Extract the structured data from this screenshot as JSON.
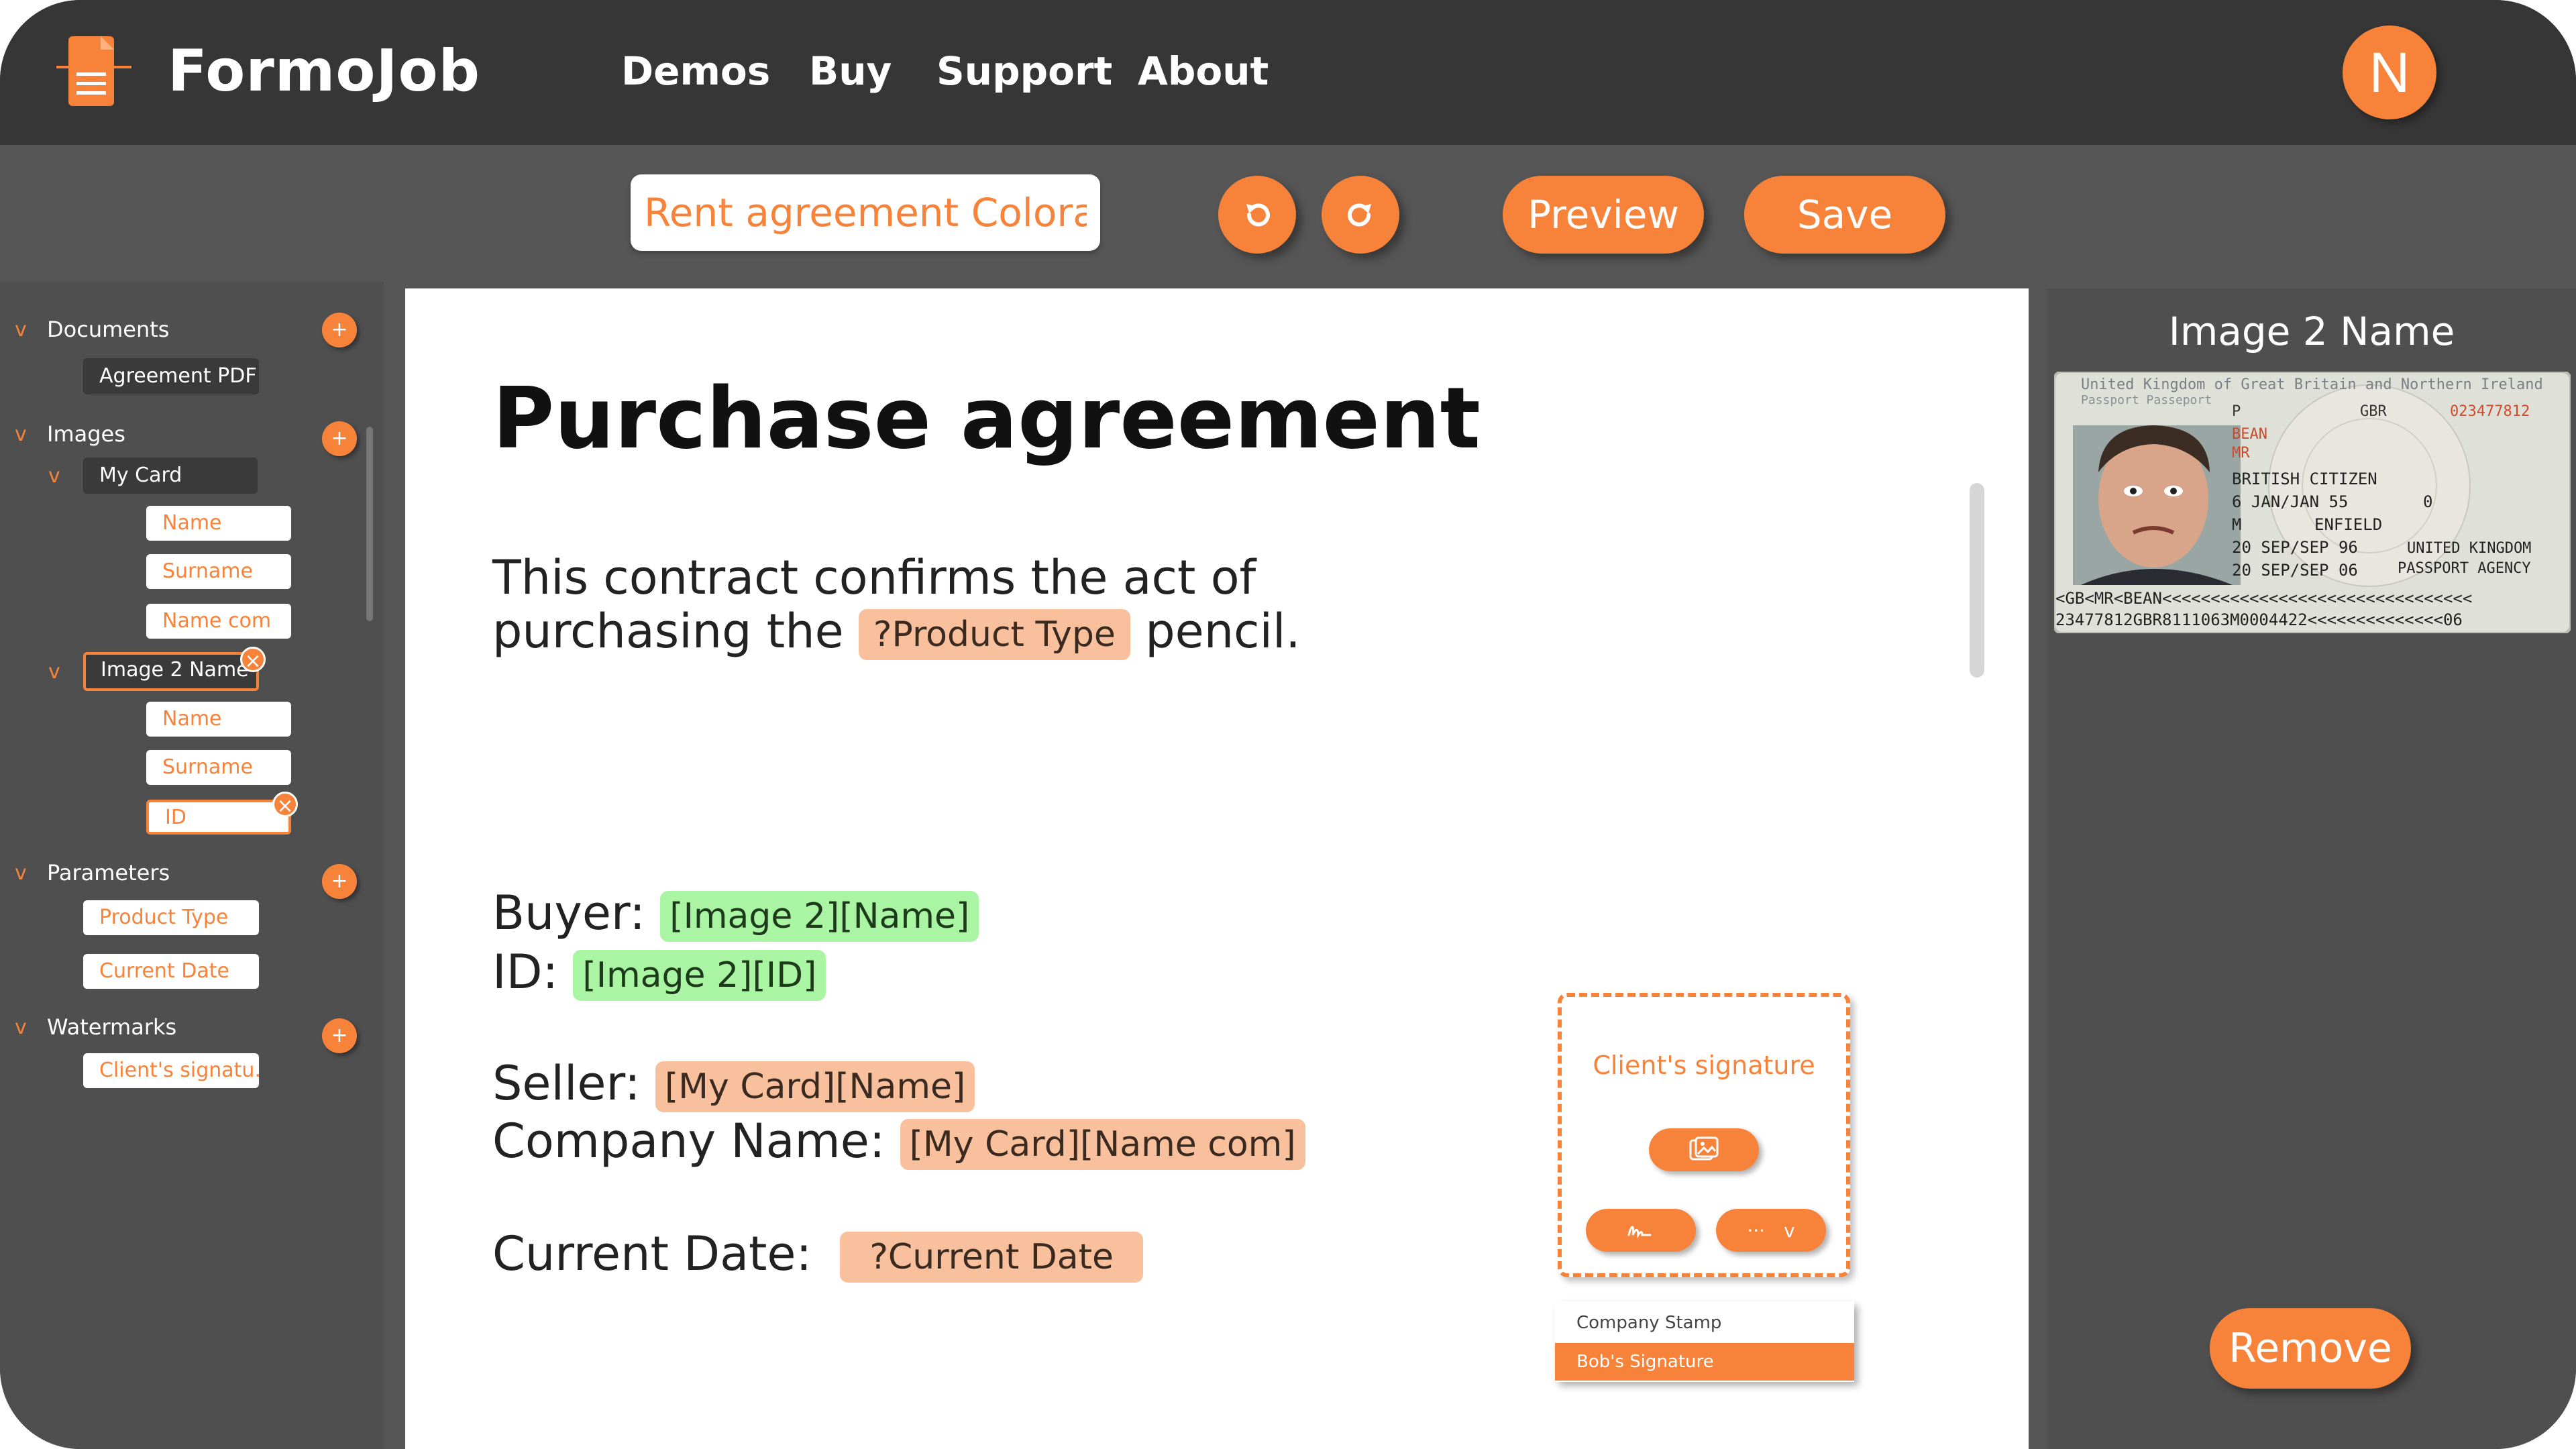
{
  "brand": {
    "name": "FormoJob"
  },
  "nav": [
    "Demos",
    "Buy",
    "Support",
    "About"
  ],
  "user": {
    "initial": "N"
  },
  "toolbar": {
    "doc_name": "Rent agreement Colorado",
    "preview_label": "Preview",
    "save_label": "Save"
  },
  "sidebar": {
    "documents": {
      "label": "Documents",
      "items": [
        "Agreement PDF"
      ]
    },
    "images": {
      "label": "Images",
      "groups": [
        {
          "name": "My Card",
          "fields": [
            "Name",
            "Surname",
            "Name com"
          ]
        },
        {
          "name": "Image 2 Name ...",
          "fields": [
            "Name",
            "Surname",
            "ID"
          ]
        }
      ]
    },
    "parameters": {
      "label": "Parameters",
      "items": [
        "Product Type",
        "Current Date"
      ]
    },
    "watermarks": {
      "label": "Watermarks",
      "items": [
        "Client's signatu..."
      ]
    }
  },
  "document": {
    "title": "Purchase agreement",
    "intro_line1": "This contract confirms the act of",
    "intro_line2_prefix": "purchasing the",
    "intro_tag": "?Product Type",
    "intro_line2_suffix": "pencil.",
    "buyer_label": "Buyer:",
    "buyer_tag": "[Image 2][Name]",
    "id_label": "ID:",
    "id_tag": "[Image 2][ID]",
    "seller_label": "Seller:",
    "seller_tag": "[My Card][Name]",
    "company_label": "Company Name:",
    "company_tag": "[My Card][Name com]",
    "date_label": "Current Date:",
    "date_tag": "?Current Date"
  },
  "signature": {
    "label": "Client's signature",
    "more_label": "···",
    "menu": [
      "Company Stamp",
      "Bob's Signature"
    ]
  },
  "right_panel": {
    "title": "Image 2 Name",
    "remove_label": "Remove",
    "passport": {
      "header": "United Kingdom of Great Britain and Northern Ireland",
      "sub": "Passport Passeport",
      "type": "P",
      "country": "GBR",
      "number": "023477812",
      "surname": "BEAN",
      "title": "MR",
      "nationality": "BRITISH CITIZEN",
      "dob": "6 JAN/JAN 55",
      "sex": "M",
      "pob": "ENFIELD",
      "issue": "20 SEP/SEP 96",
      "expiry": "20 SEP/SEP 06",
      "authority1": "UNITED KINGDOM",
      "authority2": "PASSPORT AGENCY",
      "mrz1": "<GB<MR<BEAN<<<<<<<<<<<<<<<<<<<<<<<<<<<<<<<<",
      "mrz2": "23477812GBR8111063M0004422<<<<<<<<<<<<<<06"
    }
  },
  "colors": {
    "accent": "#f7833a",
    "topbar": "#363636",
    "background": "#565656",
    "tag_orange": "#f9c09d",
    "tag_green": "#a9f5a3"
  }
}
